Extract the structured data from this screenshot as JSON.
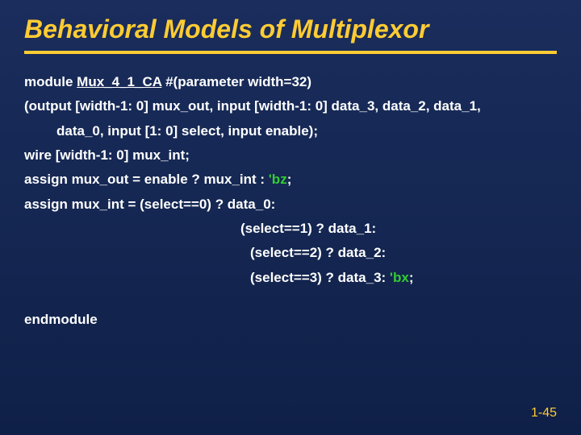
{
  "title": "Behavioral Models of Multiplexor",
  "code": {
    "line1_pre": "module ",
    "line1_name": "Mux_4_1_CA",
    "line1_post": " #(parameter width=32)",
    "line2": "(output [width-1: 0] mux_out, input [width-1: 0] data_3, data_2, data_1,",
    "line2b": "data_0, input [1: 0] select, input enable);",
    "line3": "wire [width-1: 0] mux_int;",
    "line4_pre": "assign mux_out = enable ? mux_int : ",
    "line4_green": "'bz",
    "line4_post": ";",
    "line5": "assign mux_int = (select==0) ? data_0:",
    "line6": "(select==1) ? data_1:",
    "line7": "(select==2)  ? data_2:",
    "line8_pre": "(select==3) ? data_3:  ",
    "line8_green": "'bx",
    "line8_post": ";",
    "end": "endmodule"
  },
  "pageNumber": "1-45"
}
